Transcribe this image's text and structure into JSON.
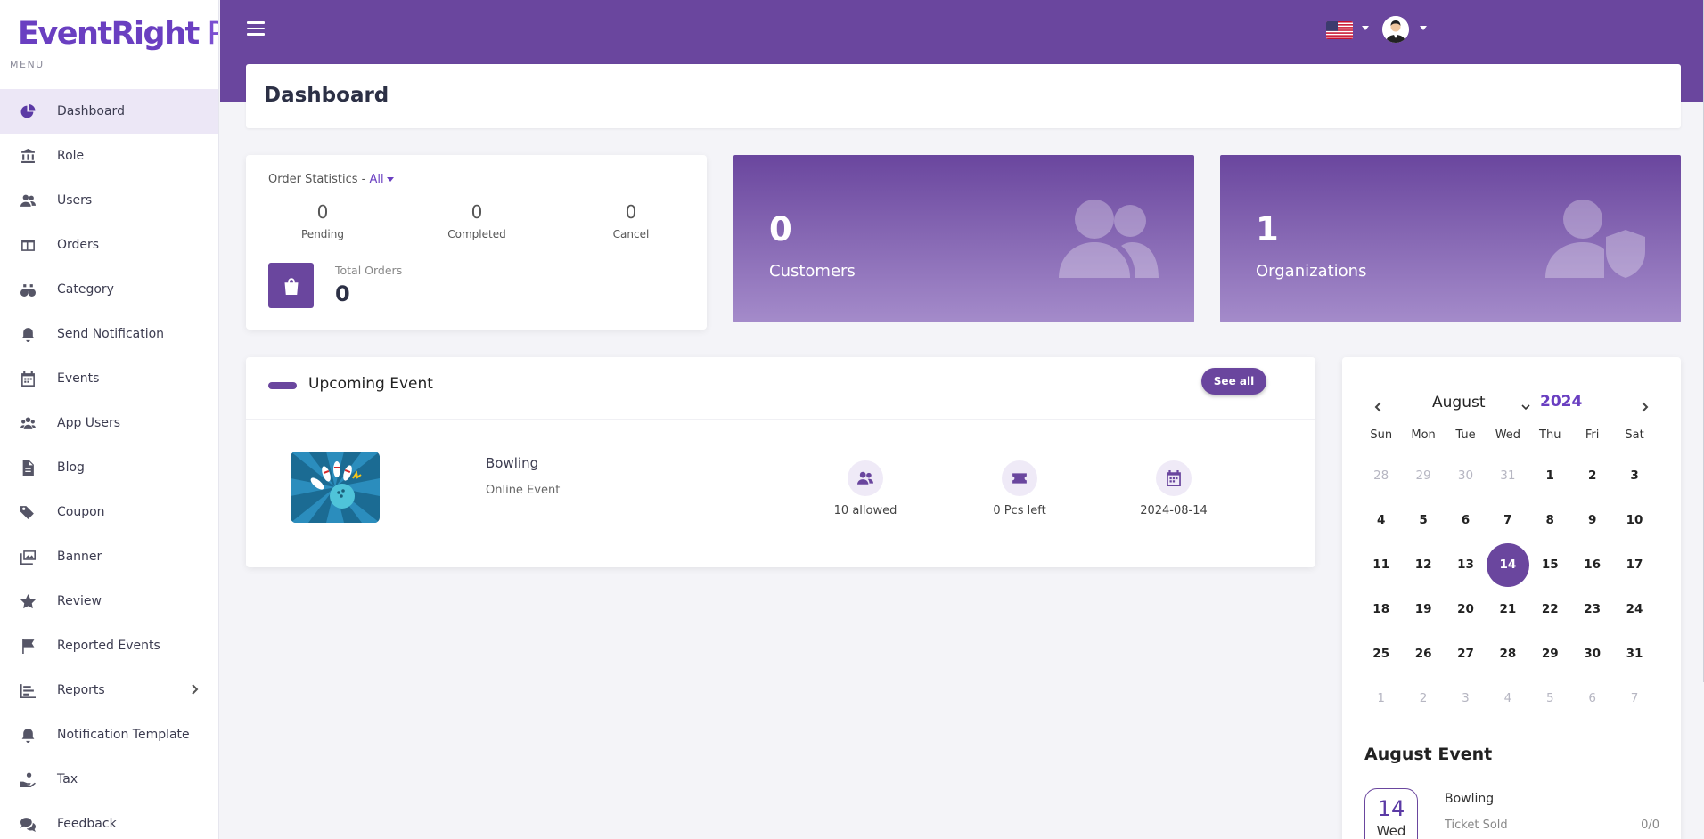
{
  "brand": {
    "name": "EventRight",
    "suffix": " Pro",
    "accent": "#6a469e"
  },
  "sidebar": {
    "menu_label": "MENU",
    "items": [
      {
        "label": "Dashboard",
        "icon": "pie-chart-icon"
      },
      {
        "label": "Role",
        "icon": "bank-icon"
      },
      {
        "label": "Users",
        "icon": "users-icon"
      },
      {
        "label": "Orders",
        "icon": "table-icon"
      },
      {
        "label": "Category",
        "icon": "binoculars-icon"
      },
      {
        "label": "Send Notification",
        "icon": "bell-icon"
      },
      {
        "label": "Events",
        "icon": "calendar-icon"
      },
      {
        "label": "App Users",
        "icon": "user-group-icon"
      },
      {
        "label": "Blog",
        "icon": "file-icon"
      },
      {
        "label": "Coupon",
        "icon": "tags-icon"
      },
      {
        "label": "Banner",
        "icon": "images-icon"
      },
      {
        "label": "Review",
        "icon": "star-icon"
      },
      {
        "label": "Reported Events",
        "icon": "flag-icon"
      },
      {
        "label": "Reports",
        "icon": "bar-chart-icon"
      },
      {
        "label": "Notification Template",
        "icon": "bell-icon"
      },
      {
        "label": "Tax",
        "icon": "hand-coin-icon"
      },
      {
        "label": "Feedback",
        "icon": "comments-icon"
      }
    ]
  },
  "header": {
    "menu_icon": "hamburger-icon",
    "language_icon": "us-flag-icon",
    "avatar_icon": "user-avatar-icon"
  },
  "page": {
    "title": "Dashboard"
  },
  "order_stats": {
    "label": "Order Statistics - ",
    "filter": "All",
    "pending": {
      "value": "0",
      "label": "Pending"
    },
    "completed": {
      "value": "0",
      "label": "Completed"
    },
    "cancel": {
      "value": "0",
      "label": "Cancel"
    },
    "total_label": "Total Orders",
    "total_value": "0"
  },
  "customers": {
    "value": "0",
    "label": "Customers"
  },
  "organizations": {
    "value": "1",
    "label": "Organizations"
  },
  "upcoming": {
    "title": "Upcoming Event",
    "see_all": "See all",
    "event": {
      "name": "Bowling",
      "type": "Online Event",
      "allowed": "10 allowed",
      "left": "0 Pcs left",
      "date": "2024-08-14"
    }
  },
  "calendar": {
    "month": "August",
    "year": "2024",
    "weekdays": [
      "Sun",
      "Mon",
      "Tue",
      "Wed",
      "Thu",
      "Fri",
      "Sat"
    ],
    "weeks": [
      [
        "28",
        "29",
        "30",
        "31",
        "1",
        "2",
        "3"
      ],
      [
        "4",
        "5",
        "6",
        "7",
        "8",
        "9",
        "10"
      ],
      [
        "11",
        "12",
        "13",
        "14",
        "15",
        "16",
        "17"
      ],
      [
        "18",
        "19",
        "20",
        "21",
        "22",
        "23",
        "24"
      ],
      [
        "25",
        "26",
        "27",
        "28",
        "29",
        "30",
        "31"
      ],
      [
        "1",
        "2",
        "3",
        "4",
        "5",
        "6",
        "7"
      ]
    ],
    "selected": "14"
  },
  "month_events": {
    "title": "August Event",
    "day": "14",
    "weekday": "Wed",
    "name": "Bowling",
    "ticket_label": "Ticket Sold",
    "ticket_value": "0/0"
  }
}
